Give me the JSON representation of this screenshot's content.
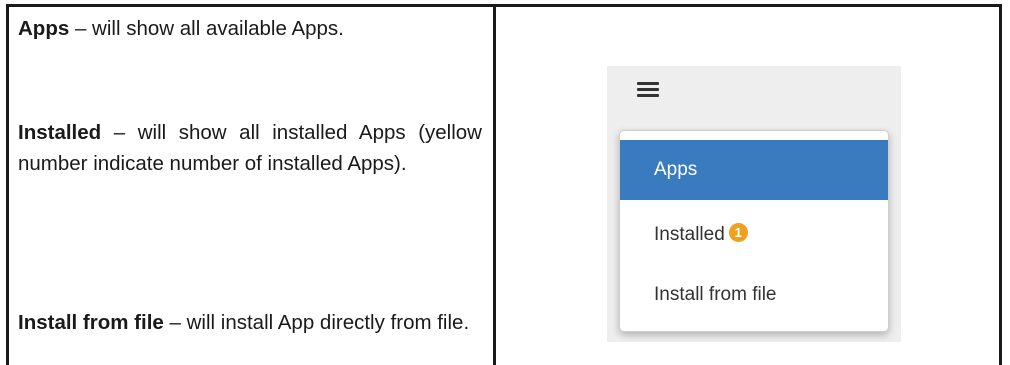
{
  "rows": [
    {
      "term": "Apps",
      "text": " – will show all available Apps."
    },
    {
      "term": "Installed",
      "text": " – will show all installed Apps (yellow number indicate number of installed Apps)."
    },
    {
      "term": "Install from file",
      "text": " – will install App directly from file."
    }
  ],
  "menu": {
    "hamburger_icon": "hamburger-menu-icon",
    "items": [
      {
        "label": "Apps",
        "active": true
      },
      {
        "label": "Installed",
        "badge": "1"
      },
      {
        "label": "Install from file"
      }
    ],
    "colors": {
      "active_bg": "#3a7abf",
      "badge_bg": "#f0a020"
    }
  }
}
